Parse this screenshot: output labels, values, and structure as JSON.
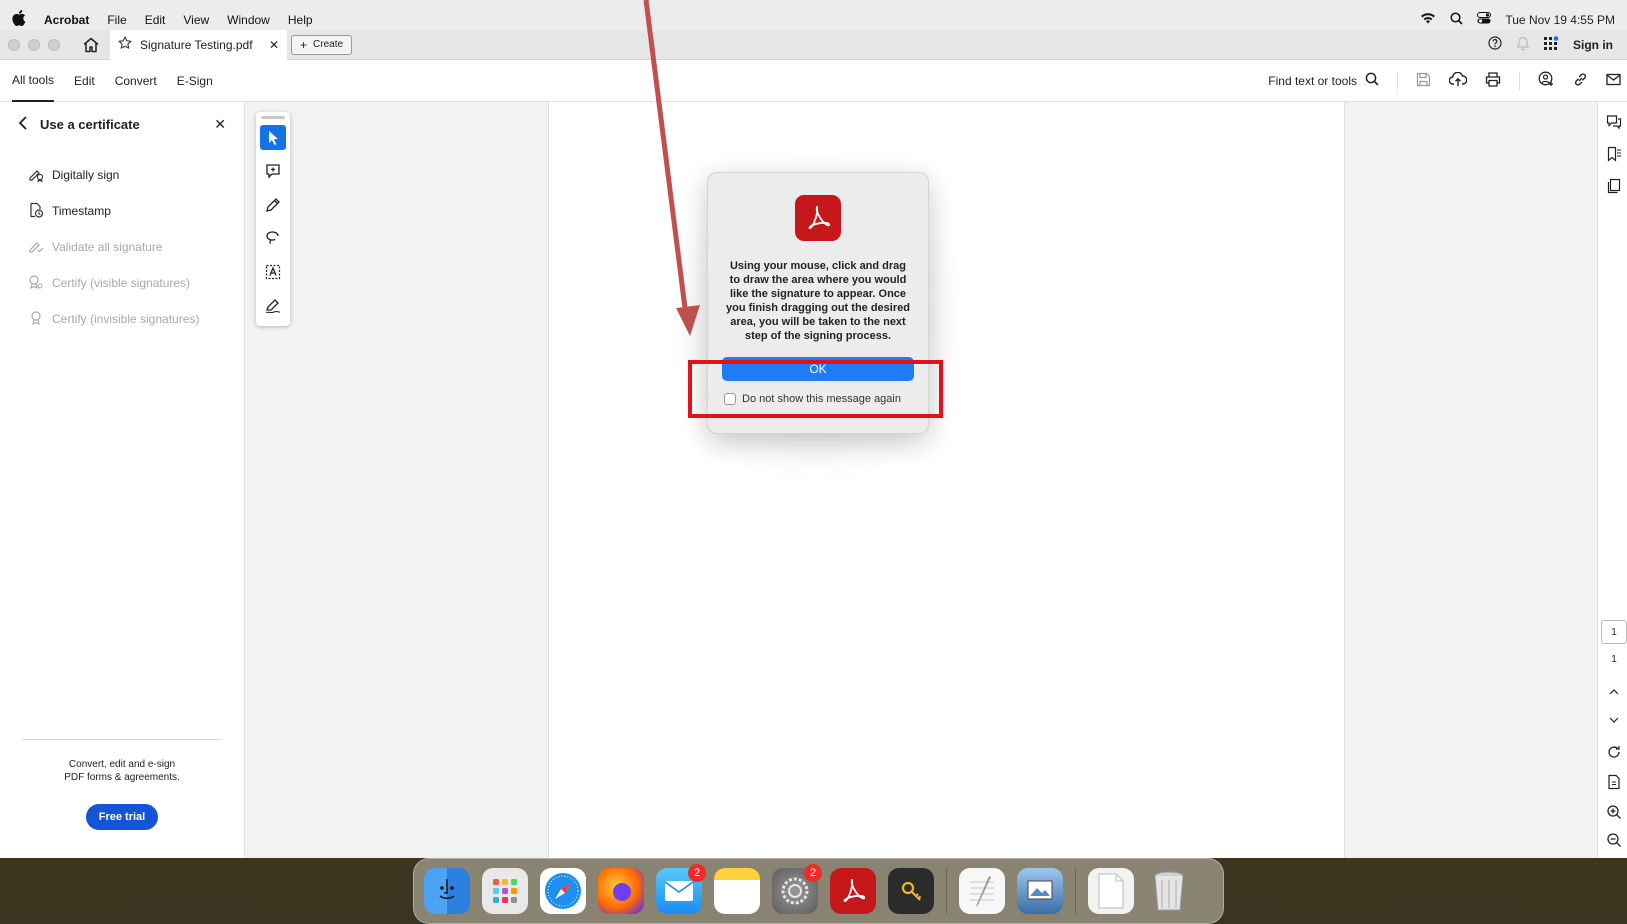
{
  "menubar": {
    "apple": "",
    "app_name": "Acrobat",
    "menus": [
      "File",
      "Edit",
      "View",
      "Window",
      "Help"
    ],
    "datetime": "Tue Nov 19  4:55 PM"
  },
  "tabbar": {
    "tab_title": "Signature Testing.pdf",
    "create_label": "Create",
    "sign_in": "Sign in"
  },
  "toolbar": {
    "tabs": [
      "All tools",
      "Edit",
      "Convert",
      "E-Sign"
    ],
    "find_label": "Find text or tools"
  },
  "left_panel": {
    "title": "Use a certificate",
    "items": [
      {
        "label": "Digitally sign",
        "enabled": true
      },
      {
        "label": "Timestamp",
        "enabled": true
      },
      {
        "label": "Validate all signature",
        "enabled": false
      },
      {
        "label": "Certify (visible signatures)",
        "enabled": false
      },
      {
        "label": "Certify (invisible signatures)",
        "enabled": false
      }
    ],
    "footer_line1": "Convert, edit and e-sign",
    "footer_line2": "PDF forms & agreements.",
    "trial_button": "Free trial"
  },
  "right_rail": {
    "page_current": "1",
    "page_total": "1"
  },
  "dialog": {
    "message": "Using your mouse, click and drag to draw the area where you would like the signature to appear. Once you finish dragging out the desired area, you will be taken to the next step of the signing process.",
    "ok_label": "OK",
    "checkbox_label": "Do not show this message again"
  },
  "dock": {
    "mail_badge": "2",
    "settings_badge": "2"
  },
  "colors": {
    "accent_blue": "#1473e6",
    "ok_blue": "#1e7cf7",
    "acrobat_red": "#c6181b",
    "annotation_red": "#e0121a"
  }
}
